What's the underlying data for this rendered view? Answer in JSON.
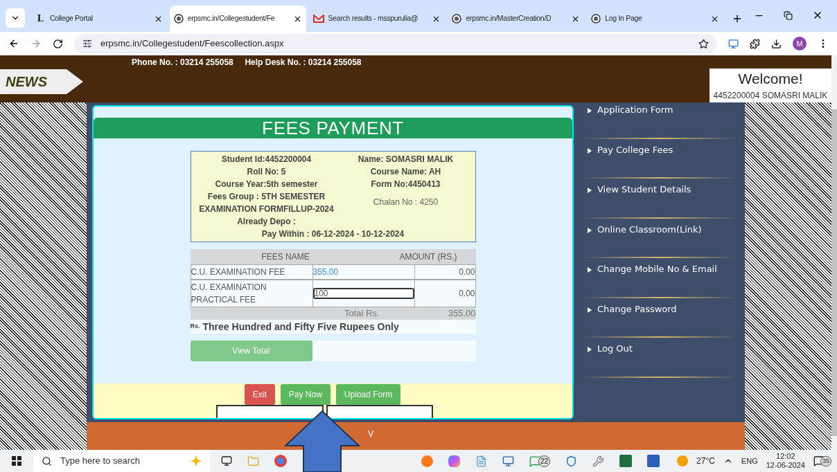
{
  "browser": {
    "tabs": [
      {
        "title": "College Portal",
        "selected": false,
        "kind": "letter",
        "logo": "L"
      },
      {
        "title": "erpsmc.in/Collegestudent/Fe",
        "selected": true,
        "kind": "site"
      },
      {
        "title": "Search results - msspurulia@",
        "selected": false,
        "kind": "mail"
      },
      {
        "title": "erpsmc.in/MasterCreation/D",
        "selected": false,
        "kind": "site"
      },
      {
        "title": "Log In Page",
        "selected": false,
        "kind": "site"
      }
    ],
    "address": "erpsmc.in/Collegestudent/Feescollection.aspx",
    "profile": "M"
  },
  "header": {
    "contact": "Phone No. : 03214 255058     Help Desk No. : 03214 255058",
    "news": "NEWS",
    "welcome": "Welcome!",
    "user": "4452200004 SOMASRI MALIK"
  },
  "form": {
    "title": "FEES PAYMENT",
    "info_left": [
      "Student Id:4452200004",
      "Roll No: 5",
      "Course Year:5th semester",
      "Fees Group : 5TH SEMESTER EXAMINATION FORMFILLUP-2024",
      "Already Depo :"
    ],
    "info_right": [
      "Name: SOMASRI MALIK",
      "Course Name: AH",
      "Form No:4450413"
    ],
    "chalan": "Chalan No : 4250",
    "pay_within": "Pay Within : 06-12-2024 - 10-12-2024",
    "columns": [
      "FEES NAME",
      "AMOUNT (RS.)"
    ],
    "rows": [
      {
        "name": "C.U. EXAMINATION FEE",
        "kind": "text",
        "amount": "355.00",
        "column_3": "0.00"
      },
      {
        "name": "C.U. EXAMINATION PRACTICAL FEE",
        "kind": "input",
        "amount": "100",
        "column_3": "0.00"
      }
    ],
    "total_label": "Total Rs.",
    "total": "355.00",
    "words_prefix": "Rs.",
    "words": "Three Hundred and Fifty Five Rupees Only",
    "view_total": "View Total",
    "buttons": [
      {
        "label": "Exit",
        "kind": "danger"
      },
      {
        "label": "Pay Now",
        "kind": "success"
      },
      {
        "label": "Upload Form",
        "kind": "success"
      }
    ]
  },
  "sidebar": {
    "items": [
      "Application Form",
      "Pay College Fees",
      "View Student Details",
      "Online Classroom(Link)",
      "Change Mobile No & Email",
      "Change Password",
      "Log Out"
    ]
  },
  "footer": {
    "text": "V"
  },
  "taskbar": {
    "search_placeholder": "Type here to search",
    "whatsapp_badge": "22",
    "temperature": "27°C",
    "language": "ENG",
    "time": "12:02",
    "date": "12-06-2024",
    "notifications": "35"
  }
}
